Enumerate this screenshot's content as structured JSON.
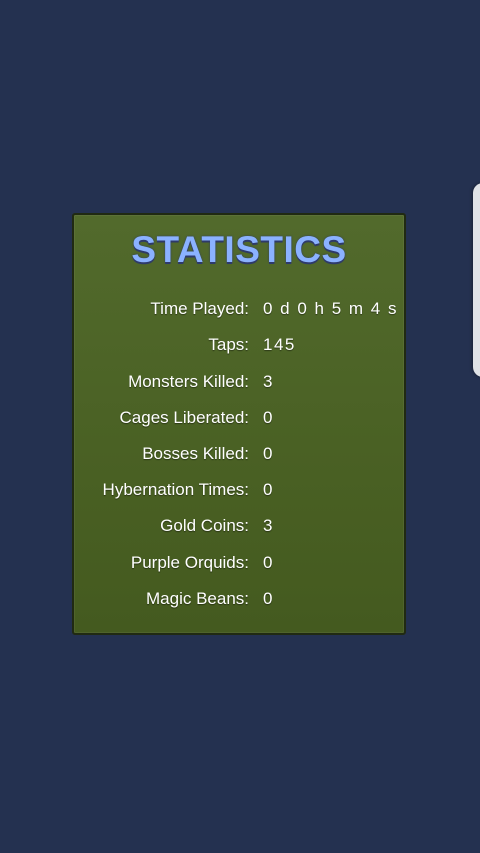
{
  "panel": {
    "title": "STATISTICS",
    "rows": [
      {
        "label": "Time Played:",
        "value": "0 d 0 h 5 m 4 s"
      },
      {
        "label": "Taps:",
        "value": "145"
      },
      {
        "label": "Monsters Killed:",
        "value": "3"
      },
      {
        "label": "Cages Liberated:",
        "value": "0"
      },
      {
        "label": "Bosses Killed:",
        "value": "0"
      },
      {
        "label": "Hybernation Times:",
        "value": "0"
      },
      {
        "label": "Gold Coins:",
        "value": "3"
      },
      {
        "label": "Purple Orquids:",
        "value": "0"
      },
      {
        "label": "Magic Beans:",
        "value": "0"
      }
    ]
  },
  "colors": {
    "background": "#243150",
    "panel": "#4a6124",
    "title": "#8bb2ff"
  }
}
